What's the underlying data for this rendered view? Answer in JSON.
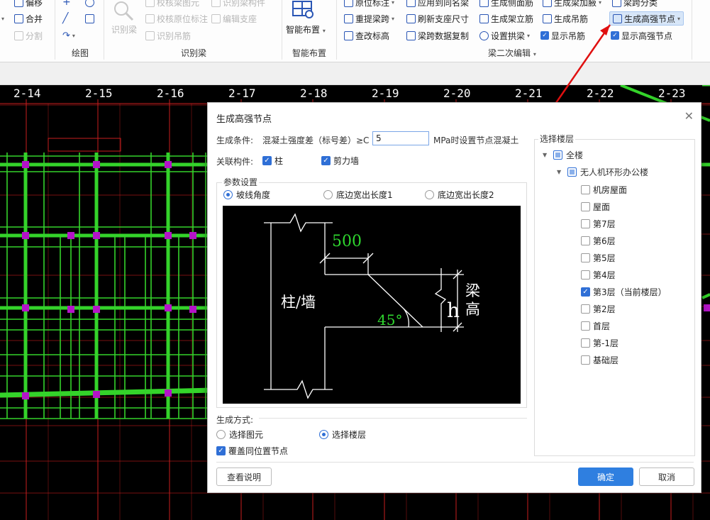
{
  "ribbon": {
    "left_items": [
      "偏移",
      "合并",
      "分割"
    ],
    "draw_group": "绘图",
    "identify_group": {
      "label": "识别梁",
      "big_button": "识别梁",
      "items": [
        "校核梁图元",
        "识别梁构件",
        "校核原位标注",
        "编辑支座",
        "识别吊筋"
      ]
    },
    "smart_group": {
      "label": "智能布置",
      "button": "智能布置"
    },
    "beam2_group": {
      "label": "梁二次编辑",
      "col1": [
        "原位标注",
        "重提梁跨",
        "查改标高"
      ],
      "col2": [
        "应用到同名梁",
        "刷新支座尺寸",
        "梁跨数据复制"
      ],
      "col3": [
        "生成侧面筋",
        "生成架立筋",
        "设置拱梁"
      ],
      "col4": [
        "生成梁加腋",
        "生成吊筋"
      ],
      "col5": [
        "梁跨分类",
        "生成高强节点"
      ],
      "show_rebar": "显示吊筋",
      "show_node": "显示高强节点"
    }
  },
  "cad": {
    "axis_labels": [
      "2-14",
      "2-15",
      "2-16",
      "2-17",
      "2-18",
      "2-19",
      "2-20",
      "2-21",
      "2-22",
      "2-23"
    ],
    "bg_color": "#000000",
    "beam_color": "#34d32a",
    "grid_color": "#c81e1e",
    "node_color": "#b414c8"
  },
  "dialog": {
    "title": "生成高强节点",
    "condition_label": "生成条件:",
    "condition_text": "混凝土强度差（标号差）≥C",
    "diff_value": "5",
    "condition_suffix": "MPa时设置节点混凝土",
    "related_label": "关联构件:",
    "related": [
      {
        "label": "柱",
        "checked": true
      },
      {
        "label": "剪力墙",
        "checked": true
      }
    ],
    "param_title": "参数设置",
    "param_options": [
      {
        "label": "坡线角度",
        "selected": true
      },
      {
        "label": "底边宽出长度1",
        "selected": false
      },
      {
        "label": "底边宽出长度2",
        "selected": false
      }
    ],
    "diagram": {
      "dim_500": "500",
      "angle": "45°",
      "col_wall": "柱/墙",
      "h": "h",
      "beam_height": [
        "梁",
        "高"
      ]
    },
    "method_label": "生成方式:",
    "method_options": [
      {
        "label": "选择图元",
        "selected": false
      },
      {
        "label": "选择楼层",
        "selected": true
      }
    ],
    "cover_label": "覆盖同位置节点",
    "cover_checked": true,
    "floor_title": "选择楼层",
    "floor_root": "全楼",
    "floor_project": "无人机环形办公楼",
    "floors": [
      {
        "label": "机房屋面",
        "checked": false
      },
      {
        "label": "屋面",
        "checked": false
      },
      {
        "label": "第7层",
        "checked": false
      },
      {
        "label": "第6层",
        "checked": false
      },
      {
        "label": "第5层",
        "checked": false
      },
      {
        "label": "第4层",
        "checked": false
      },
      {
        "label": "第3层（当前楼层）",
        "checked": true
      },
      {
        "label": "第2层",
        "checked": false
      },
      {
        "label": "首层",
        "checked": false
      },
      {
        "label": "第-1层",
        "checked": false
      },
      {
        "label": "基础层",
        "checked": false
      }
    ],
    "help_button": "查看说明",
    "ok_button": "确定",
    "cancel_button": "取消",
    "accent_color": "#2f7fe0"
  }
}
